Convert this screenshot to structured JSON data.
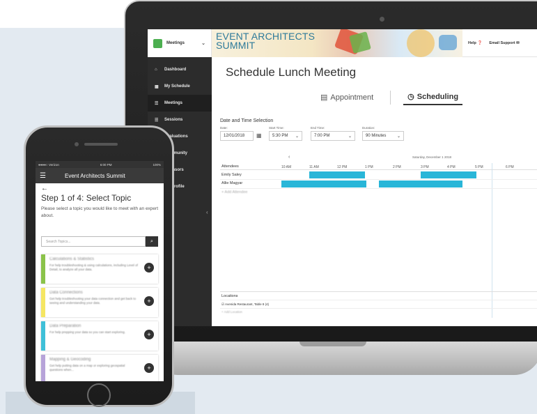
{
  "laptop_app": {
    "menu_select": {
      "label": "Meetings"
    },
    "banner": {
      "title": "EVENT ARCHITECTS SUMMIT"
    },
    "top_links": [
      "Help",
      "Email Support"
    ],
    "sidebar": {
      "items": [
        {
          "icon": "home-icon",
          "label": "Dashboard"
        },
        {
          "icon": "calendar-icon",
          "label": "My Schedule"
        },
        {
          "icon": "meetings-icon",
          "label": "Meetings"
        },
        {
          "icon": "sessions-icon",
          "label": "Sessions"
        },
        {
          "icon": "evaluations-icon",
          "label": "Evaluations"
        },
        {
          "icon": "community-icon",
          "label": "Community"
        },
        {
          "icon": "sponsors-icon",
          "label": "Sponsors"
        },
        {
          "icon": "profile-icon",
          "label": "My Profile"
        }
      ]
    },
    "page_title": "Schedule Lunch Meeting",
    "tabs": [
      {
        "icon": "appointment-icon",
        "label": "Appointment"
      },
      {
        "icon": "clock-icon",
        "label": "Scheduling"
      }
    ],
    "date_time": {
      "section_title": "Date and Time Selection",
      "date_label": "Date:",
      "date_value": "12/01/2018",
      "start_label": "Start Time:",
      "start_value": "5:30 PM",
      "end_label": "End Time:",
      "end_value": "7:00 PM",
      "duration_label": "Duration:",
      "duration_value": "90 Minutes"
    },
    "scheduler": {
      "date_heading": "Saturday, December 1 2018",
      "attendees_label": "Attendees",
      "hours": [
        "10 AM",
        "11 AM",
        "12 PM",
        "1 PM",
        "2 PM",
        "3 PM",
        "4 PM",
        "5 PM",
        "6 PM"
      ],
      "attendees": [
        "Emily Saley",
        "Allie Magyar"
      ],
      "add_attendee": "+ Add Attendee",
      "locations_label": "Locations",
      "location_item": "Avenida Restaurant, Table 8 (4)",
      "add_location": "+ Add Location"
    }
  },
  "phone_app": {
    "status": {
      "carrier": "●●●●○ Verizon",
      "time": "6:00 PM",
      "battery": "100%"
    },
    "app_title": "Event Architects Summit",
    "step_title": "Step 1 of 4: Select Topic",
    "step_desc": "Please select a topic you would like to meet with an expert about.",
    "search_placeholder": "Search Topics...",
    "topics": [
      {
        "title": "Calculations & Statistics",
        "desc": "For help troubleshooting & using calculations, including Level of Detail, to analyze all your data.",
        "color": "#8bc34a"
      },
      {
        "title": "Data Connections",
        "desc": "Get help troubleshooting your data connection and get back to seeing and understanding your data.",
        "color": "#f5e663"
      },
      {
        "title": "Data Preparation",
        "desc": "For help prepping your data so you can start exploring.",
        "color": "#3fc0d8"
      },
      {
        "title": "Mapping & Geocoding",
        "desc": "Get help putting data on a map or exploring geospatial questions when...",
        "color": "#b7a3d9"
      }
    ]
  }
}
